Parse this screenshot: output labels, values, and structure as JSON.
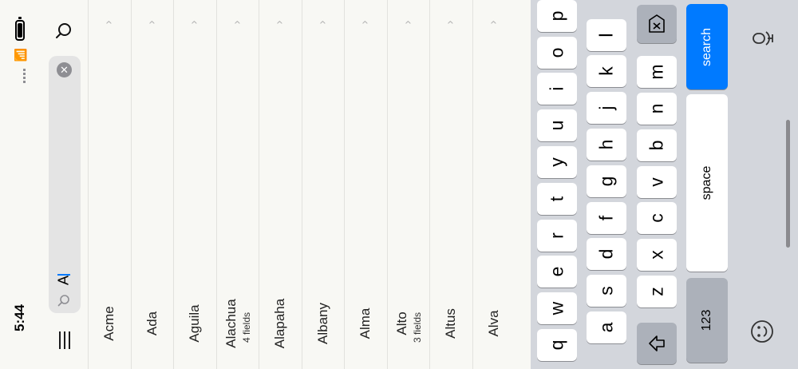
{
  "status": {
    "time": "5:44"
  },
  "search": {
    "query": "A"
  },
  "results": [
    {
      "name": "Acme",
      "sub": ""
    },
    {
      "name": "Ada",
      "sub": ""
    },
    {
      "name": "Aguila",
      "sub": ""
    },
    {
      "name": "Alachua",
      "sub": "4 fields"
    },
    {
      "name": "Alapaha",
      "sub": ""
    },
    {
      "name": "Albany",
      "sub": ""
    },
    {
      "name": "Alma",
      "sub": ""
    },
    {
      "name": "Alto",
      "sub": "3 fields"
    },
    {
      "name": "Altus",
      "sub": ""
    },
    {
      "name": "Alva",
      "sub": ""
    }
  ],
  "keyboard": {
    "row1": [
      "q",
      "w",
      "e",
      "r",
      "t",
      "y",
      "u",
      "i",
      "o",
      "p"
    ],
    "row2": [
      "a",
      "s",
      "d",
      "f",
      "g",
      "h",
      "j",
      "k",
      "l"
    ],
    "row3": [
      "z",
      "x",
      "c",
      "v",
      "b",
      "n",
      "m"
    ],
    "numbers_label": "123",
    "space_label": "space",
    "search_label": "search"
  }
}
